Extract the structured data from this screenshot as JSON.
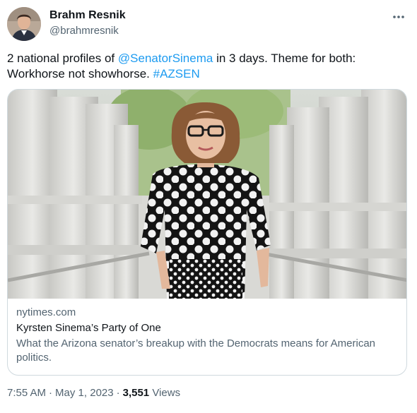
{
  "author": {
    "display_name": "Brahm Resnik",
    "handle": "@brahmresnik"
  },
  "tweet": {
    "text_part1": "2 national profiles of ",
    "mention": "@SenatorSinema",
    "text_part2": " in 3 days. Theme for both: Workhorse not showhorse. ",
    "hashtag": "#AZSEN"
  },
  "card": {
    "domain": "nytimes.com",
    "title": "Kyrsten Sinema’s Party of One",
    "description": "What the Arizona senator’s breakup with the Democrats means for American politics."
  },
  "meta": {
    "time": "7:55 AM",
    "date": "May 1, 2023",
    "views_count": "3,551",
    "views_label": "Views"
  },
  "icons": {
    "more": "more-horizontal-icon"
  },
  "colors": {
    "link": "#1d9bf0",
    "secondary_text": "#536471",
    "border": "#cfd9de"
  }
}
